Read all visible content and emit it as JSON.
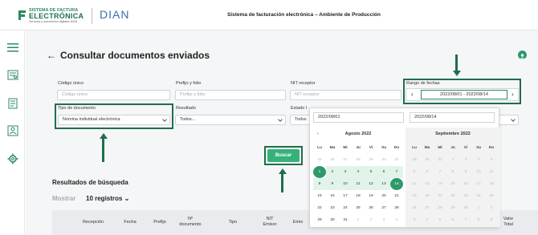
{
  "header": {
    "logo_line1": "SISTEMA DE FACTURA",
    "logo_line2": "ELECTRÓNICA",
    "logo_line3": "Servicios y documentos digitales DIAN",
    "dian": "DIAN",
    "title": "Sistema de facturación electrónica – Ambiente de Producción"
  },
  "sidebar": {
    "items": [
      {
        "icon": "hamburger-menu-icon"
      },
      {
        "icon": "invoice-icon"
      },
      {
        "icon": "document-list-icon"
      },
      {
        "icon": "users-icon"
      },
      {
        "icon": "gear-icon"
      }
    ]
  },
  "page": {
    "back": "←",
    "title": "Consultar documentos enviados"
  },
  "form": {
    "codigo_unico_label": "Código único",
    "codigo_unico_placeholder": "Código único",
    "prefijo_label": "Prefijo y folio",
    "prefijo_placeholder": "Prefijo y folio",
    "nit_label": "NIT receptor",
    "nit_placeholder": "NIT receptor",
    "rango_label": "Rango de fechas",
    "rango_value": "2022/08/01 - 2022/08/14",
    "tipo_label": "Tipo de documento",
    "tipo_value": "Nomina individual electrónica",
    "resultado_label": "Resultado",
    "resultado_value": "Todos...",
    "estado_label": "Estado I",
    "estado_value": "Todos"
  },
  "datepicker": {
    "start": "2022/08/01",
    "end": "2022/08/14",
    "weekdays": [
      "Lu",
      "Ma",
      "Mi",
      "Ju",
      "Vi",
      "Sa",
      "Do"
    ],
    "left_title": "Agosto 2022",
    "right_title": "Septiembre 2022",
    "left_weeks": [
      [
        "25",
        "26",
        "27",
        "28",
        "29",
        "30",
        "31"
      ],
      [
        "1",
        "2",
        "3",
        "4",
        "5",
        "6",
        "7"
      ],
      [
        "8",
        "9",
        "10",
        "11",
        "12",
        "13",
        "14"
      ],
      [
        "15",
        "16",
        "17",
        "18",
        "19",
        "20",
        "21"
      ],
      [
        "22",
        "23",
        "24",
        "25",
        "26",
        "27",
        "28"
      ],
      [
        "29",
        "30",
        "31",
        "1",
        "2",
        "3",
        "4"
      ]
    ],
    "right_weeks": [
      [
        "29",
        "30",
        "31",
        "1",
        "2",
        "3",
        "4"
      ],
      [
        "5",
        "6",
        "7",
        "8",
        "9",
        "10",
        "11"
      ],
      [
        "12",
        "13",
        "14",
        "15",
        "16",
        "17",
        "18"
      ],
      [
        "19",
        "20",
        "21",
        "22",
        "23",
        "24",
        "25"
      ],
      [
        "26",
        "27",
        "28",
        "29",
        "30",
        "1",
        "2"
      ],
      [
        "3",
        "4",
        "5",
        "6",
        "7",
        "8",
        "9"
      ]
    ]
  },
  "actions": {
    "buscar": "Buscar"
  },
  "results": {
    "title": "Resultados de búsqueda",
    "mostrar": "Mostrar",
    "page_size": "10 registros",
    "columns": [
      "Recepción",
      "Fecha",
      "Prefijo",
      "Nº documento",
      "Tipo",
      "NIT Emisor",
      "Emis",
      "Valor Total"
    ]
  },
  "colors": {
    "accent": "#1f6e4c",
    "button": "#35b27a",
    "selected_day": "#2e9a6b"
  }
}
